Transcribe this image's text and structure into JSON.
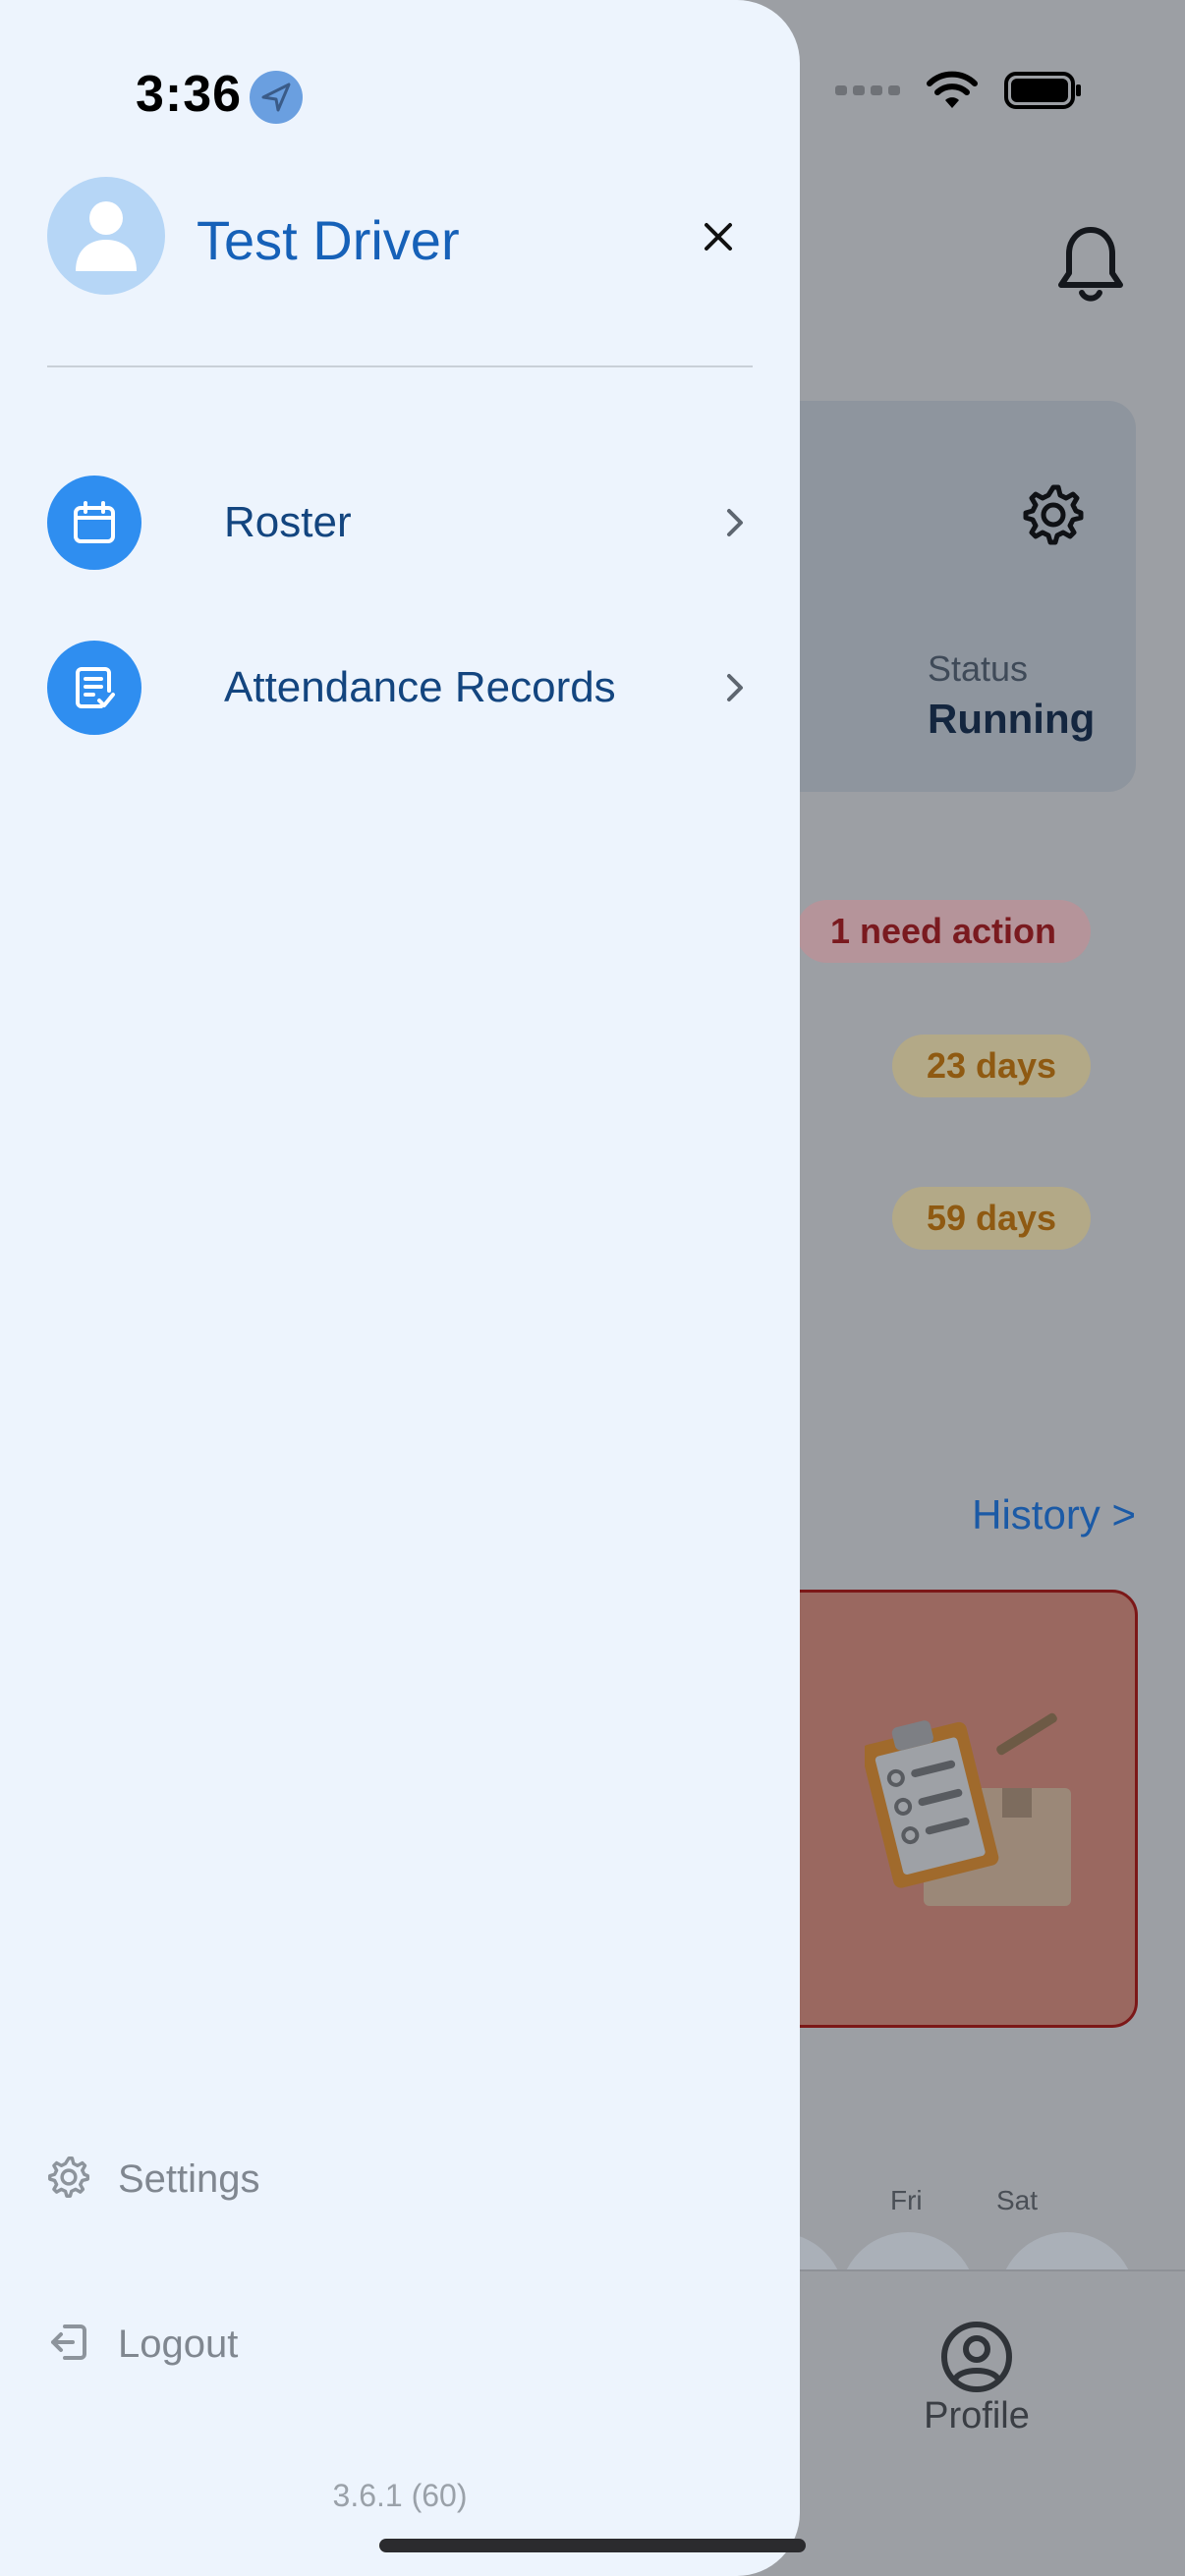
{
  "status_bar": {
    "time": "3:36"
  },
  "drawer": {
    "user_name": "Test Driver",
    "menu": [
      {
        "label": "Roster",
        "icon": "calendar-icon"
      },
      {
        "label": "Attendance Records",
        "icon": "document-check-icon"
      }
    ],
    "settings_label": "Settings",
    "logout_label": "Logout",
    "version": "3.6.1 (60)"
  },
  "background": {
    "status_label": "Status",
    "status_value": "Running",
    "badges": [
      "1 need action",
      "23 days",
      "59 days"
    ],
    "history_link": "History >",
    "days": [
      "Fri",
      "Sat"
    ],
    "profile_tab_label": "Profile"
  },
  "colors": {
    "drawer_bg": "#edf4fd",
    "accent": "#2f8ef0",
    "name_blue": "#1661b8",
    "menu_text": "#13457f",
    "overlay": "#9c9fa4"
  }
}
